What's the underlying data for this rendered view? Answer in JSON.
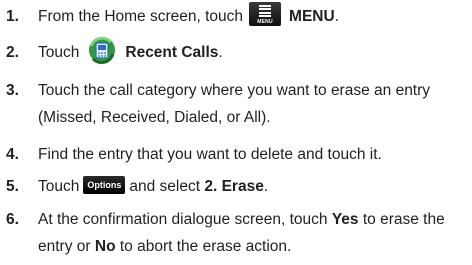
{
  "steps": [
    {
      "number": "1.",
      "before": "From the Home screen, touch",
      "icon": "menu-icon",
      "icon_caption": "MENU",
      "bold": "MENU",
      "after": "."
    },
    {
      "number": "2.",
      "before": "Touch",
      "icon": "recent-calls-icon",
      "bold": "Recent Calls",
      "after": "."
    },
    {
      "number": "3.",
      "text": "Touch the call category where you want to erase an entry (Missed, Received, Dialed, or All)."
    },
    {
      "number": "4.",
      "text": "Find the entry that you want to delete and touch it."
    },
    {
      "number": "5.",
      "before": "Touch",
      "icon": "options-icon",
      "icon_label": "Options",
      "middle": "and select",
      "bold": "2. Erase",
      "after": "."
    },
    {
      "number": "6.",
      "before": "At the confirmation dialogue screen, touch",
      "bold1": "Yes",
      "middle": "to erase the entry or",
      "bold2": "No",
      "after": "to abort the erase action."
    }
  ],
  "colors": {
    "text": "#231f20",
    "icon_dark": "#1a1a1a",
    "icon_green": "#2e9a3c",
    "icon_blue": "#2a6fc0"
  }
}
